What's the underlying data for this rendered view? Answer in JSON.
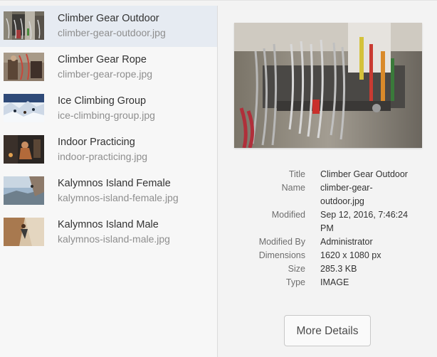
{
  "assets": [
    {
      "title": "Climber Gear Outdoor",
      "file": "climber-gear-outdoor.jpg",
      "selected": true,
      "thumb": "gear-outdoor-thumb"
    },
    {
      "title": "Climber Gear Rope",
      "file": "climber-gear-rope.jpg",
      "selected": false,
      "thumb": "gear-rope-thumb"
    },
    {
      "title": "Ice Climbing Group",
      "file": "ice-climbing-group.jpg",
      "selected": false,
      "thumb": "ice-group-thumb"
    },
    {
      "title": "Indoor Practicing",
      "file": "indoor-practicing.jpg",
      "selected": false,
      "thumb": "indoor-thumb"
    },
    {
      "title": "Kalymnos Island Female",
      "file": "kalymnos-island-female.jpg",
      "selected": false,
      "thumb": "kalymnos-female-thumb"
    },
    {
      "title": "Kalymnos Island Male",
      "file": "kalymnos-island-male.jpg",
      "selected": false,
      "thumb": "kalymnos-male-thumb"
    }
  ],
  "details": {
    "title_label": "Title",
    "title_value": "Climber Gear Outdoor",
    "name_label": "Name",
    "name_value": "climber-gear-outdoor.jpg",
    "modified_label": "Modified",
    "modified_value": "Sep 12, 2016, 7:46:24 PM",
    "modified_by_label": "Modified By",
    "modified_by_value": "Administrator",
    "dimensions_label": "Dimensions",
    "dimensions_value": "1620 x 1080 px",
    "size_label": "Size",
    "size_value": "285.3 KB",
    "type_label": "Type",
    "type_value": "IMAGE"
  },
  "more_details_label": "More Details",
  "colors": {
    "selected_row": "#e6ebf2",
    "title_text": "#323232",
    "secondary_text": "#8e8e8e"
  }
}
